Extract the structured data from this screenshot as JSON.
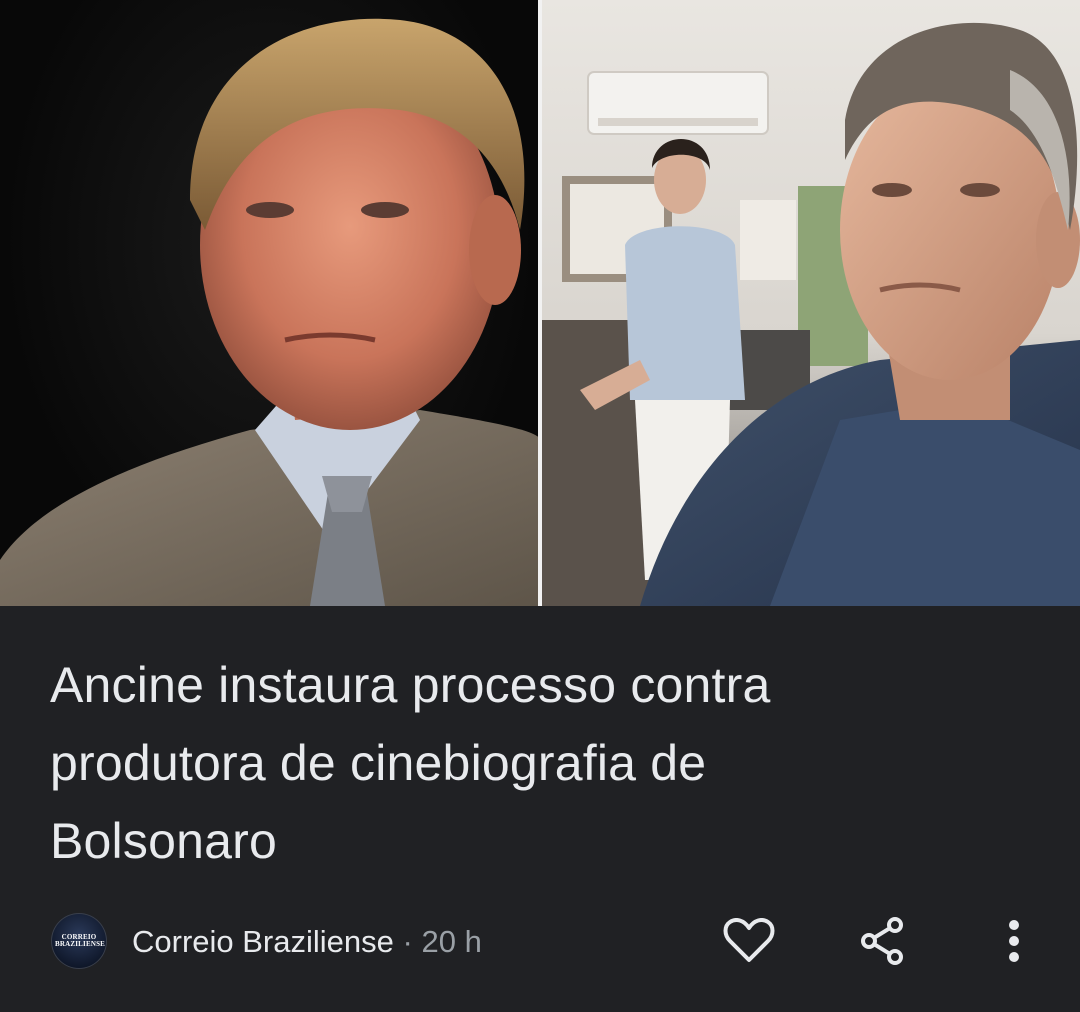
{
  "article": {
    "headline_lines": [
      "Ancine instaura processo contra",
      "produtora de cinebiografia de",
      "Bolsonaro"
    ]
  },
  "source": {
    "name": "Correio Braziliense",
    "separator": "·",
    "time": "20 h",
    "logo_lines": [
      "CORREIO",
      "BRAZILIENSE"
    ]
  },
  "actions": {
    "like_icon": "heart-outline-icon",
    "share_icon": "share-icon",
    "more_icon": "more-vertical-icon"
  },
  "colors": {
    "background": "#202124",
    "headline_text": "#e8eaed",
    "secondary_text": "#9aa0a6",
    "icon": "#e8eaed"
  }
}
